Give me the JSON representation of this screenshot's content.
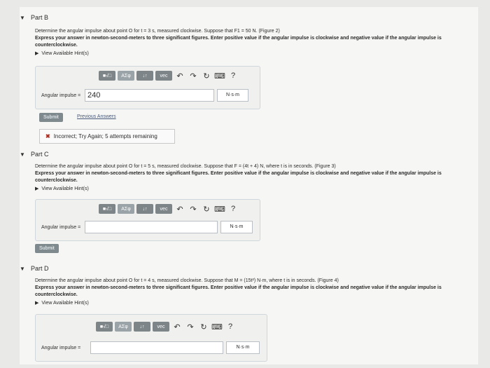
{
  "partB": {
    "title": "Part B",
    "problem": "Determine the angular impulse about point O for t = 3 s, measured clockwise. Suppose that F1 = 50 N. (Figure 2)",
    "express": "Express your answer in newton-second-meters to three significant figures. Enter positive value if the angular impulse is clockwise and negative value if the angular impulse is counterclockwise.",
    "hints": "View Available Hint(s)",
    "label": "Angular impulse =",
    "value": "240",
    "units": "N·s·m",
    "submit": "Submit",
    "previous": "Previous Answers",
    "feedback": "Incorrect; Try Again; 5 attempts remaining"
  },
  "partC": {
    "title": "Part C",
    "problem": "Determine the angular impulse about point O for t = 5 s, measured clockwise. Suppose that F = (4t + 4) N, where t is in seconds. (Figure 3)",
    "express": "Express your answer in newton-second-meters to three significant figures. Enter positive value if the angular impulse is clockwise and negative value if the angular impulse is counterclockwise.",
    "hints": "View Available Hint(s)",
    "label": "Angular impulse =",
    "units": "N·s·m",
    "submit": "Submit"
  },
  "partD": {
    "title": "Part D",
    "problem": "Determine the angular impulse about point O for t = 4 s, measured clockwise. Suppose that M = (15t²) N·m, where t is in seconds. (Figure 4)",
    "express": "Express your answer in newton-second-meters to three significant figures. Enter positive value if the angular impulse is clockwise and negative value if the angular impulse is counterclockwise.",
    "hints": "View Available Hint(s)",
    "label": "Angular impulse =",
    "units": "N·s·m"
  },
  "toolbar": {
    "b1": "■√□",
    "b2": "ΑΣφ",
    "b3": "↓↑",
    "b4": "vec",
    "help": "?"
  }
}
